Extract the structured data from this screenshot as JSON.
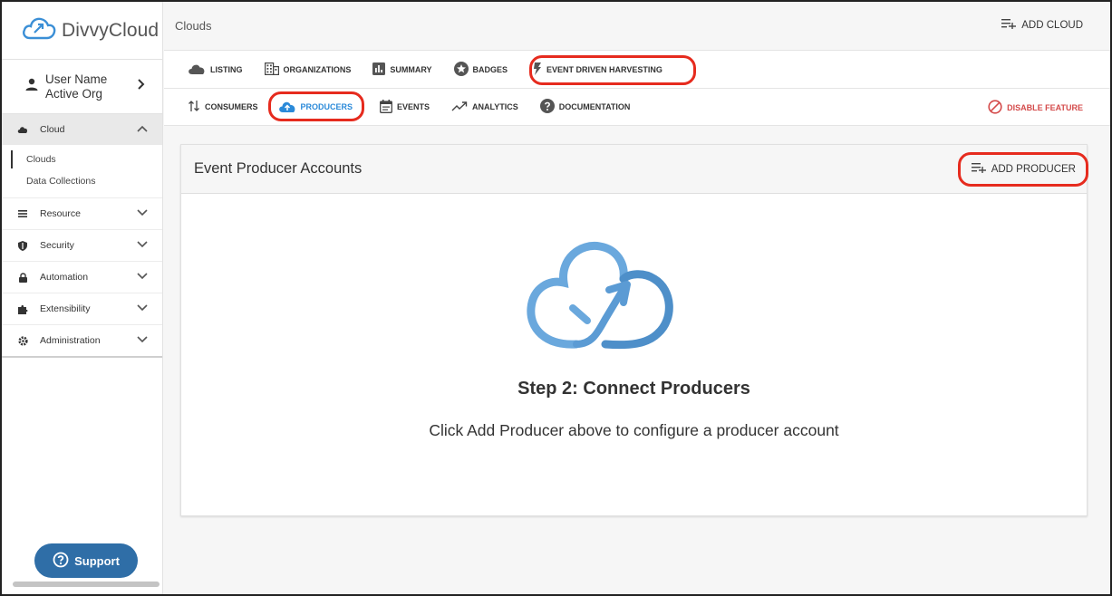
{
  "app": {
    "logo_text": "DivvyCloud"
  },
  "user": {
    "name": "User Name",
    "org": "Active Org"
  },
  "sidebar": {
    "cloud_label": "Cloud",
    "cloud_items": [
      "Clouds",
      "Data Collections"
    ],
    "sections": [
      {
        "label": "Resource",
        "icon": "list-icon"
      },
      {
        "label": "Security",
        "icon": "shield-icon"
      },
      {
        "label": "Automation",
        "icon": "lock-icon"
      },
      {
        "label": "Extensibility",
        "icon": "puzzle-icon"
      },
      {
        "label": "Administration",
        "icon": "gear-icon"
      }
    ],
    "support_label": "Support"
  },
  "header": {
    "title": "Clouds",
    "add_cloud_label": "ADD CLOUD"
  },
  "tabs_primary": [
    {
      "label": "LISTING",
      "icon": "cloud-icon"
    },
    {
      "label": "ORGANIZATIONS",
      "icon": "building-icon"
    },
    {
      "label": "SUMMARY",
      "icon": "bar-chart-icon"
    },
    {
      "label": "BADGES",
      "icon": "star-badge-icon"
    },
    {
      "label": "EVENT DRIVEN HARVESTING",
      "icon": "lightning-icon"
    }
  ],
  "tabs_secondary": [
    {
      "label": "CONSUMERS",
      "icon": "sort-arrows-icon"
    },
    {
      "label": "PRODUCERS",
      "icon": "cloud-upload-icon"
    },
    {
      "label": "EVENTS",
      "icon": "calendar-icon"
    },
    {
      "label": "ANALYTICS",
      "icon": "trend-icon"
    },
    {
      "label": "DOCUMENTATION",
      "icon": "help-icon"
    }
  ],
  "disable_feature_label": "DISABLE FEATURE",
  "card": {
    "title": "Event Producer Accounts",
    "add_producer_label": "ADD PRODUCER",
    "empty_title": "Step 2: Connect Producers",
    "empty_subtitle": "Click Add Producer above to configure a producer account"
  },
  "colors": {
    "accent": "#2b8ad9",
    "highlight": "#e62b1e",
    "danger": "#d44b4b",
    "support": "#2f6ea7"
  }
}
